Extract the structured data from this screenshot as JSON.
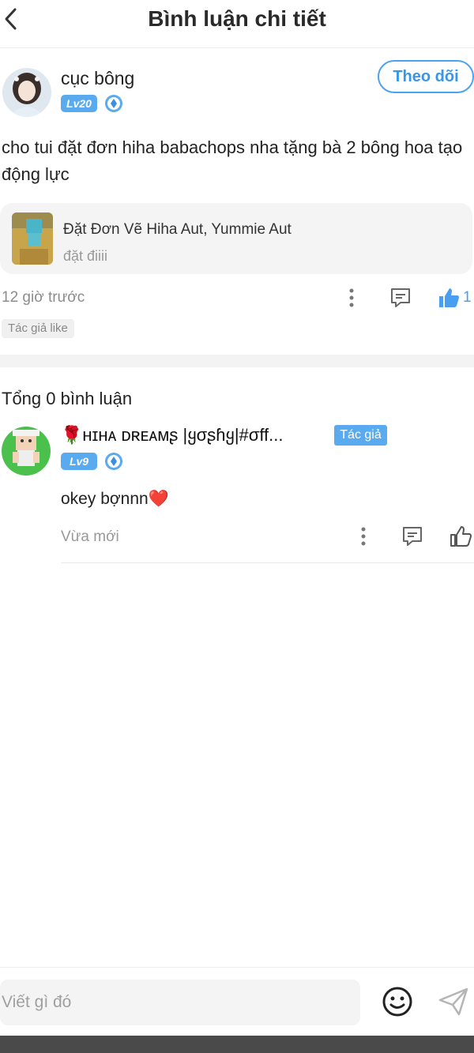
{
  "header": {
    "title": "Bình luận chi tiết"
  },
  "post": {
    "username": "cục bông",
    "level": "Lv20",
    "follow_label": "Theo dõi",
    "text": "cho tui đặt đơn hiha babachops nha tặng bà 2 bông hoa tạo động lực",
    "topic": {
      "title": "Đặt Đơn Vẽ Hiha Aut, Yummie Aut",
      "subtitle": "đặt điiii"
    },
    "time": "12 giờ trước",
    "like_count": "1",
    "author_like": "Tác giả like"
  },
  "comments_section": {
    "total_label": "Tổng 0 bình luận",
    "comments": [
      {
        "username": "🌹ʜɪʜᴀ ᴅʀᴇᴀᴍʂ |ყσʂɦყ|#σff...",
        "author_tag": "Tác giả",
        "level": "Lv9",
        "text": "okey bợnnn❤️",
        "time": "Vừa mới"
      }
    ]
  },
  "composer": {
    "placeholder": "Viết gì đó"
  },
  "colors": {
    "accent": "#4aa3f0",
    "badge": "#5aaaf0",
    "like": "#4a9ef0"
  },
  "icons": [
    "back-arrow-icon",
    "diamond-icon",
    "more-vertical-icon",
    "comment-icon",
    "thumbs-up-icon",
    "emoji-icon",
    "send-icon"
  ]
}
